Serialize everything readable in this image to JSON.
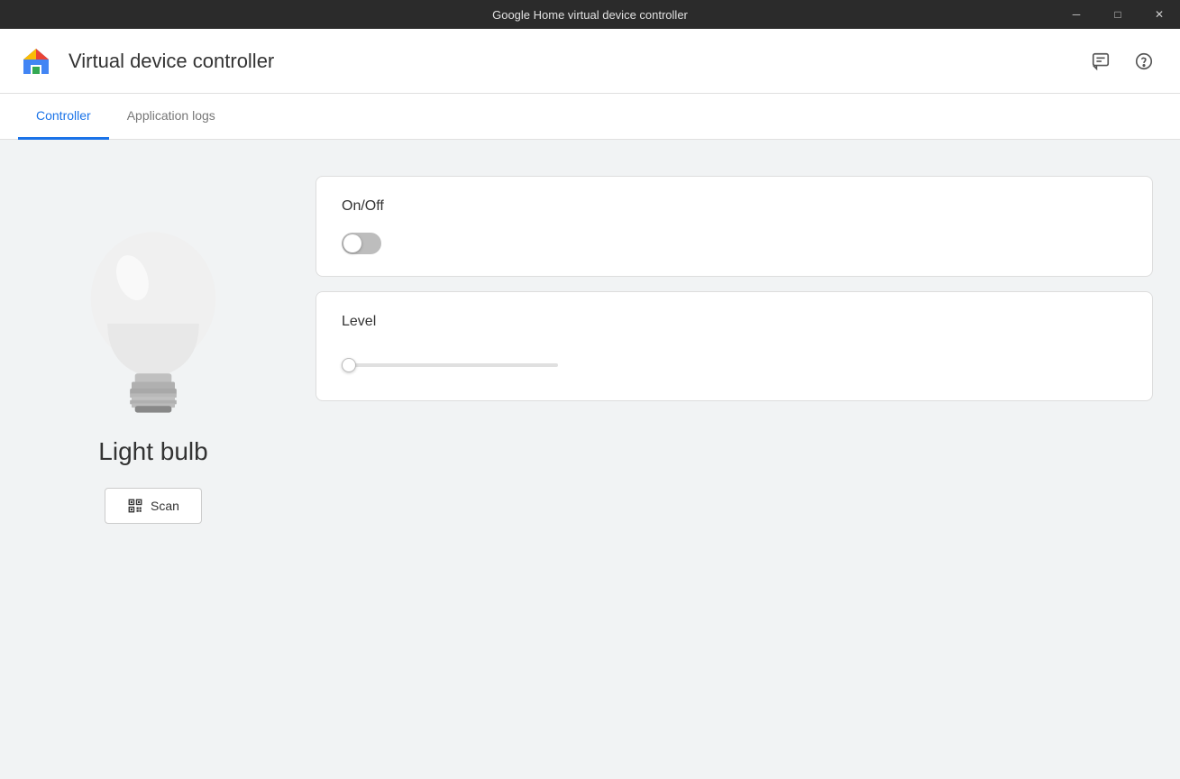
{
  "titleBar": {
    "title": "Google Home virtual device controller",
    "minimize": "─",
    "maximize": "□",
    "close": "✕"
  },
  "appHeader": {
    "title": "Virtual device controller",
    "feedbackIconLabel": "feedback-icon",
    "helpIconLabel": "help-icon"
  },
  "tabs": [
    {
      "id": "controller",
      "label": "Controller",
      "active": true
    },
    {
      "id": "application-logs",
      "label": "Application logs",
      "active": false
    }
  ],
  "leftPanel": {
    "deviceName": "Light bulb",
    "scanButton": "Scan"
  },
  "controls": [
    {
      "id": "on-off",
      "label": "On/Off",
      "type": "toggle",
      "value": false
    },
    {
      "id": "level",
      "label": "Level",
      "type": "slider",
      "value": 0,
      "min": 0,
      "max": 100
    }
  ]
}
